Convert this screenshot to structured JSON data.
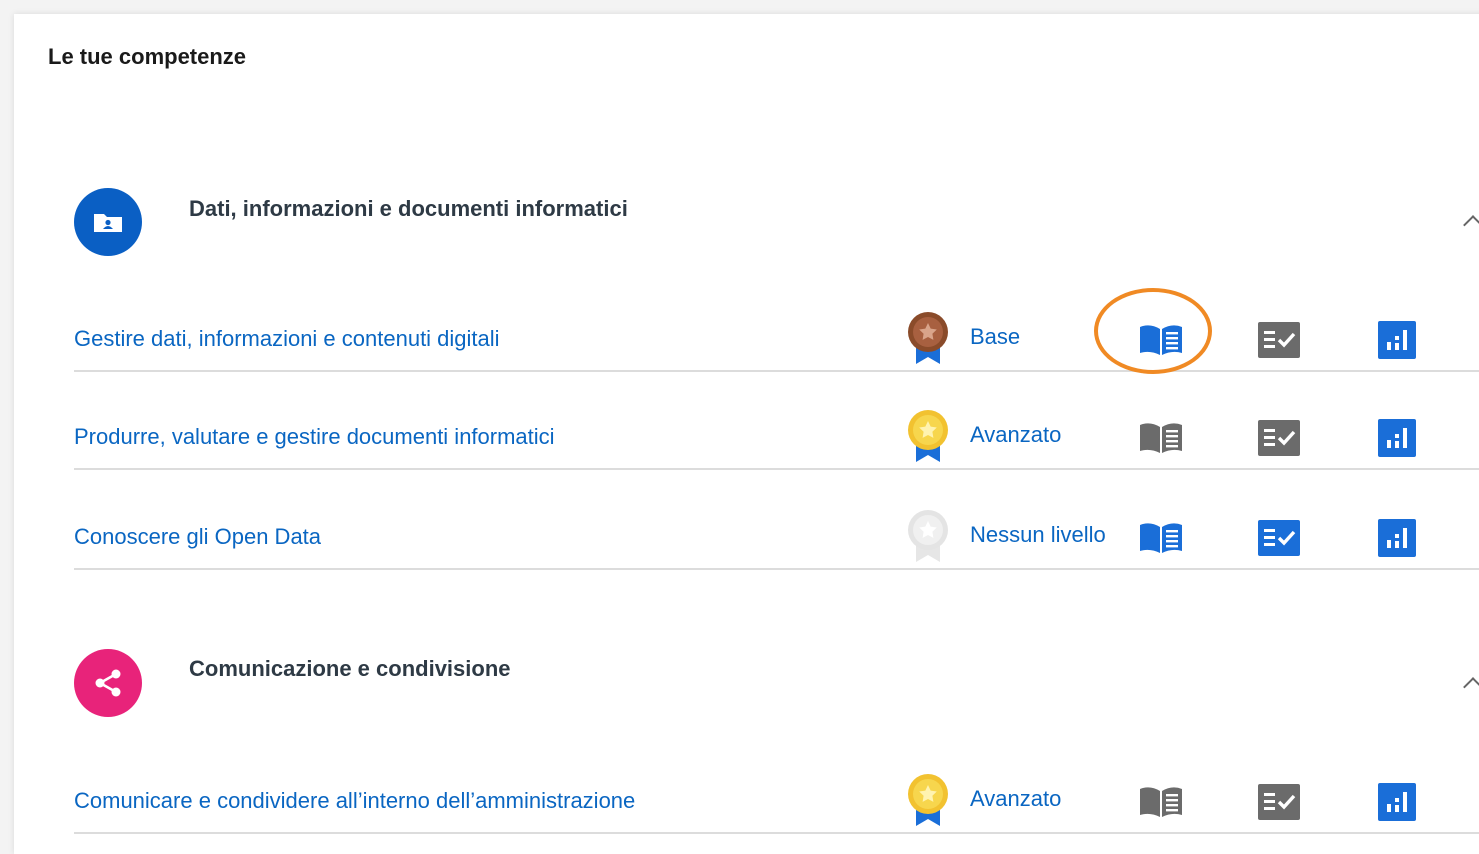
{
  "page": {
    "title": "Le tue competenze"
  },
  "colors": {
    "link_blue": "#0a66c2",
    "icon_blue": "#1a6ed8",
    "icon_gray": "#6b6b6b",
    "category_data": "#0a5fc4",
    "category_comm": "#e8237a",
    "highlight": "#f08a24",
    "medal_base": "#8a4b2a",
    "medal_avanzato": "#f2c230",
    "medal_none": "#dddddd"
  },
  "categories": [
    {
      "title": "Dati, informazioni e documenti informatici",
      "icon": "folder-user-icon",
      "rows": [
        {
          "label": "Gestire dati, informazioni e contenuti digitali",
          "level": "Base",
          "medal": "bronze-medal-icon",
          "read_active": true,
          "test_active": false,
          "highlighted": "read-button"
        },
        {
          "label": "Produrre, valutare e gestire documenti informatici",
          "level": "Avanzato",
          "medal": "gold-medal-icon",
          "read_active": false,
          "test_active": false
        },
        {
          "label": "Conoscere gli Open Data",
          "level": "Nessun livello",
          "medal": "empty-medal-icon",
          "read_active": true,
          "test_active": true
        }
      ]
    },
    {
      "title": "Comunicazione e condivisione",
      "icon": "share-icon",
      "rows": [
        {
          "label": "Comunicare e condividere all’interno dell’amministrazione",
          "level": "Avanzato",
          "medal": "gold-medal-icon",
          "read_active": false,
          "test_active": false
        }
      ]
    }
  ]
}
